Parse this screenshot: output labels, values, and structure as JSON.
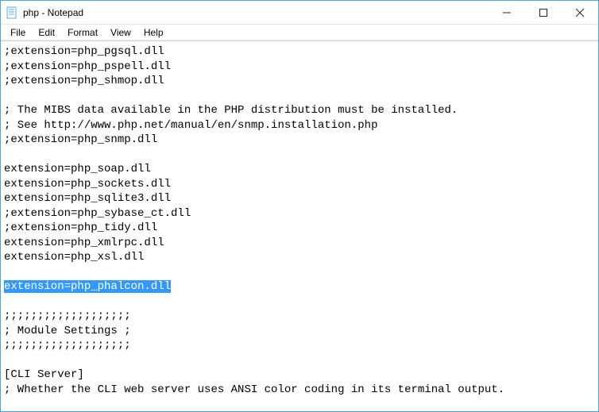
{
  "window": {
    "title": "php - Notepad",
    "icon": "notepad-icon",
    "controls": {
      "minimize": "—",
      "maximize": "☐",
      "close": "✕"
    }
  },
  "menu": {
    "file": "File",
    "edit": "Edit",
    "format": "Format",
    "view": "View",
    "help": "Help"
  },
  "editor": {
    "selected_line": "extension=php_phalcon.dll",
    "lines_before": [
      ";extension=php_pgsql.dll",
      ";extension=php_pspell.dll",
      ";extension=php_shmop.dll",
      "",
      "; The MIBS data available in the PHP distribution must be installed.",
      "; See http://www.php.net/manual/en/snmp.installation.php",
      ";extension=php_snmp.dll",
      "",
      "extension=php_soap.dll",
      "extension=php_sockets.dll",
      "extension=php_sqlite3.dll",
      ";extension=php_sybase_ct.dll",
      ";extension=php_tidy.dll",
      "extension=php_xmlrpc.dll",
      "extension=php_xsl.dll",
      ""
    ],
    "lines_after": [
      "",
      ";;;;;;;;;;;;;;;;;;;",
      "; Module Settings ;",
      ";;;;;;;;;;;;;;;;;;;",
      "",
      "[CLI Server]",
      "; Whether the CLI web server uses ANSI color coding in its terminal output."
    ]
  }
}
